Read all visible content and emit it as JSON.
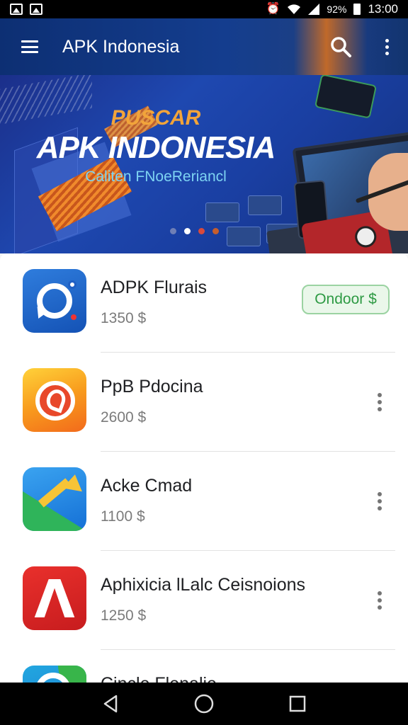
{
  "status_bar": {
    "time": "13:00",
    "battery": "92%",
    "icons": [
      "image-icon",
      "image-icon",
      "alarm-icon",
      "wifi-icon",
      "signal-icon",
      "battery-icon"
    ]
  },
  "app_bar": {
    "title": "APK Indonesia",
    "menu_icon": "menu-icon",
    "search_icon": "search-icon",
    "more_icon": "more-vert-icon"
  },
  "banner": {
    "subtitle": "PUSCAR",
    "title": "APK INDONESIA",
    "tagline": "Caliten FNoeReriancl",
    "carousel_dots": 4,
    "active_dot": 2
  },
  "apps": [
    {
      "name": "ADPK Flurais",
      "price": "1350 $",
      "action_label": "Ondoor $",
      "icon": "chat-bubble-icon"
    },
    {
      "name": "PpB Pdocina",
      "price": "2600 $",
      "icon": "orange-swirl-icon"
    },
    {
      "name": "Acke Cmad",
      "price": "1100 $",
      "icon": "green-arrow-icon"
    },
    {
      "name": "Aphixicia lLalc Ceisnoions",
      "price": "1250 $",
      "icon": "red-lambda-icon"
    },
    {
      "name": "Cincle Flenalie",
      "price": "",
      "icon": "teal-circle-icon"
    }
  ],
  "colors": {
    "app_bar": "#143d8e",
    "accent_orange": "#f2a43a",
    "install_green": "#2e9a44"
  },
  "nav_bar": {
    "icons": [
      "back-icon",
      "home-icon",
      "recents-icon"
    ]
  }
}
